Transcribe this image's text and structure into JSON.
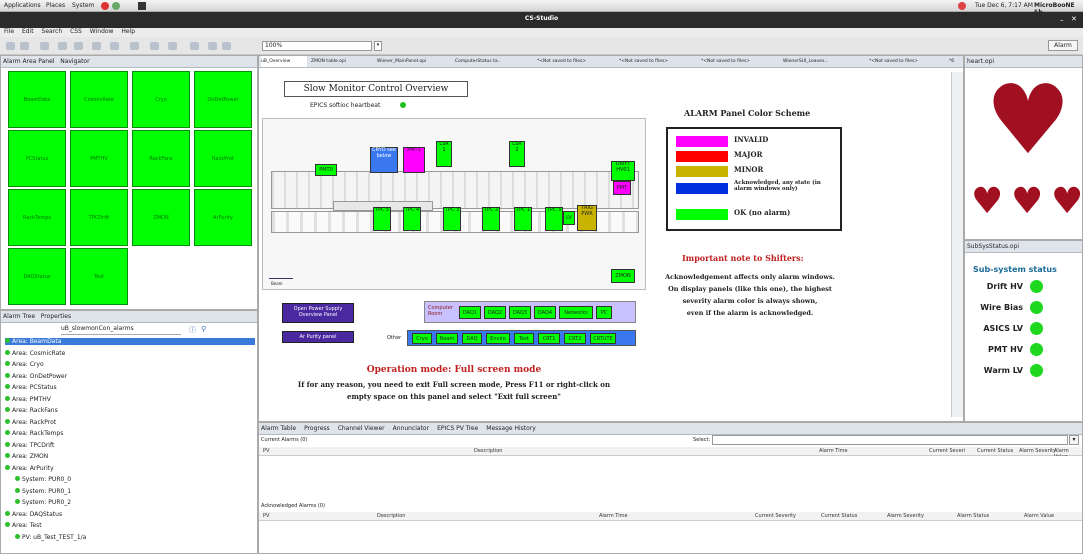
{
  "gnome": {
    "apps": "Applications",
    "places": "Places",
    "system": "System",
    "datetime": "Tue Dec 6, 7:17 AM",
    "user": "MicroBooNE Sh"
  },
  "window": {
    "title": "CS-Studio"
  },
  "menubar": [
    "File",
    "Edit",
    "Search",
    "CSS",
    "Window",
    "Help"
  ],
  "toolbar": {
    "zoom": "100%",
    "alarm_btn": "Alarm"
  },
  "left_top": {
    "tabs": [
      "Alarm Area Panel",
      "Navigator"
    ],
    "tiles": [
      "BeamData",
      "CosmicRate",
      "Cryo",
      "OnDetPower",
      "PCStatus",
      "PMTHV",
      "RackFans",
      "RackProt",
      "RackTemps",
      "TPCDrift",
      "ZMON",
      "ArPurity",
      "DAQStatus",
      "Test"
    ]
  },
  "left_bottom": {
    "tabs": [
      "Alarm Tree",
      "Properties"
    ],
    "filter": "uB_slowmonCon_alarms",
    "rows": [
      {
        "label": "Area: BeamData",
        "indent": 0,
        "selected": true
      },
      {
        "label": "Area: CosmicRate",
        "indent": 0
      },
      {
        "label": "Area: Cryo",
        "indent": 0
      },
      {
        "label": "Area: OnDetPower",
        "indent": 0
      },
      {
        "label": "Area: PCStatus",
        "indent": 0
      },
      {
        "label": "Area: PMTHV",
        "indent": 0
      },
      {
        "label": "Area: RackFans",
        "indent": 0
      },
      {
        "label": "Area: RackProt",
        "indent": 0
      },
      {
        "label": "Area: RackTemps",
        "indent": 0
      },
      {
        "label": "Area: TPCDrift",
        "indent": 0
      },
      {
        "label": "Area: ZMON",
        "indent": 0
      },
      {
        "label": "Area: ArPurity",
        "indent": 0
      },
      {
        "label": "System: PUR0_0",
        "indent": 1
      },
      {
        "label": "System: PUR0_1",
        "indent": 1
      },
      {
        "label": "System: PUR0_2",
        "indent": 1
      },
      {
        "label": "Area: DAQStatus",
        "indent": 0
      },
      {
        "label": "Area: Test",
        "indent": 0
      },
      {
        "label": "PV: uB_Test_TEST_1/a",
        "indent": 1
      }
    ]
  },
  "editor_tabs": [
    "uB_Overview",
    "ZMON table.opi",
    "Wiener_MainPanel.opi",
    "ComputerStatus ta..",
    "*<Not saved to files>",
    "*<Not saved to files>",
    "*<Not saved to files>",
    "WienerSUI_Leaves...",
    "*<Not saved to files>",
    "*6"
  ],
  "main": {
    "title": "Slow Monitor Control Overview",
    "heartbeat": "EPICS softioc heartbeat",
    "detector": {
      "cryo": "CRYO see below",
      "pmt0": "PMT0",
      "pmt1": "PMT1",
      "lsr1": "LSR 1",
      "lsr2": "LSR 2",
      "drift": "DRIFT HV01",
      "pmt_r": "PMT",
      "tpc": [
        "TPC 5",
        "TPC 4",
        "TPC 3",
        "TPC 2",
        "TPC 1",
        "TPC 3",
        "TPC 2",
        "TPC 1"
      ],
      "lv": "LV",
      "trig": "TRIG PWR",
      "zmon": "ZMON",
      "beam": "Beam"
    },
    "open_power": "Open Power Supply Overview Panel",
    "ar_purity": "Ar Purity panel",
    "computer_room_label": "Computer Room",
    "computer_room": [
      "DAQ1",
      "DAQ2",
      "DAQ3",
      "DAQ4",
      "Networks",
      "PC"
    ],
    "other_label": "Other",
    "other": [
      "Cryo",
      "Beam",
      "DAQ",
      "Enviro",
      "Test",
      "CRT1",
      "CRT2",
      "CRTUTE"
    ],
    "legend_title": "ALARM Panel Color Scheme",
    "legend": [
      {
        "color": "#ff00ff",
        "label": "INVALID"
      },
      {
        "color": "#ff0000",
        "label": "MAJOR"
      },
      {
        "color": "#c8b400",
        "label": "MINOR"
      },
      {
        "color": "#0030e0",
        "label": "Acknowledged, any state (in alarm windows only)"
      },
      {
        "color": "#00ff00",
        "label": "OK (no alarm)"
      }
    ],
    "important_title": "Important note to Shifters:",
    "important_lines": [
      "Acknowledgement affects only alarm windows.",
      "On display panels (like this one), the highest",
      "severity alarm color is always shown,",
      "even if the alarm is acknowledged."
    ],
    "opmode_title": "Operation mode: Full screen mode",
    "opmode_lines": [
      "If for any reason, you need to exit Full screen mode,  Press F11 or  right-click on",
      "empty space on this panel and select \"Exit full screen\""
    ]
  },
  "right_top": {
    "tab": "heart.opi"
  },
  "right_bottom": {
    "tab": "SubSysStatus.opi",
    "title": "Sub-system status",
    "items": [
      "Drift HV",
      "Wire Bias",
      "ASICS LV",
      "PMT HV",
      "Warm LV"
    ]
  },
  "bottom": {
    "tabs": [
      "Alarm Table",
      "Progress",
      "Channel Viewer",
      "Annunciator",
      "EPICS PV Tree",
      "Message History"
    ],
    "current_label": "Current Alarms (0)",
    "select_label": "Select:",
    "cols1": [
      "PV",
      "Description",
      "Alarm Time",
      "Current Severi",
      "Current Status",
      "Alarm Severity",
      "Alarm Value"
    ],
    "ack_label": "Acknowledged Alarms (0)",
    "cols2": [
      "PV",
      "Description",
      "Alarm Time",
      "Current Severity",
      "Current Status",
      "Alarm Severity",
      "Alarm Status",
      "Alarm Value"
    ]
  },
  "colors": {
    "ok": "#00ff00",
    "invalid": "#ff00ff",
    "heart": "#a01020"
  }
}
